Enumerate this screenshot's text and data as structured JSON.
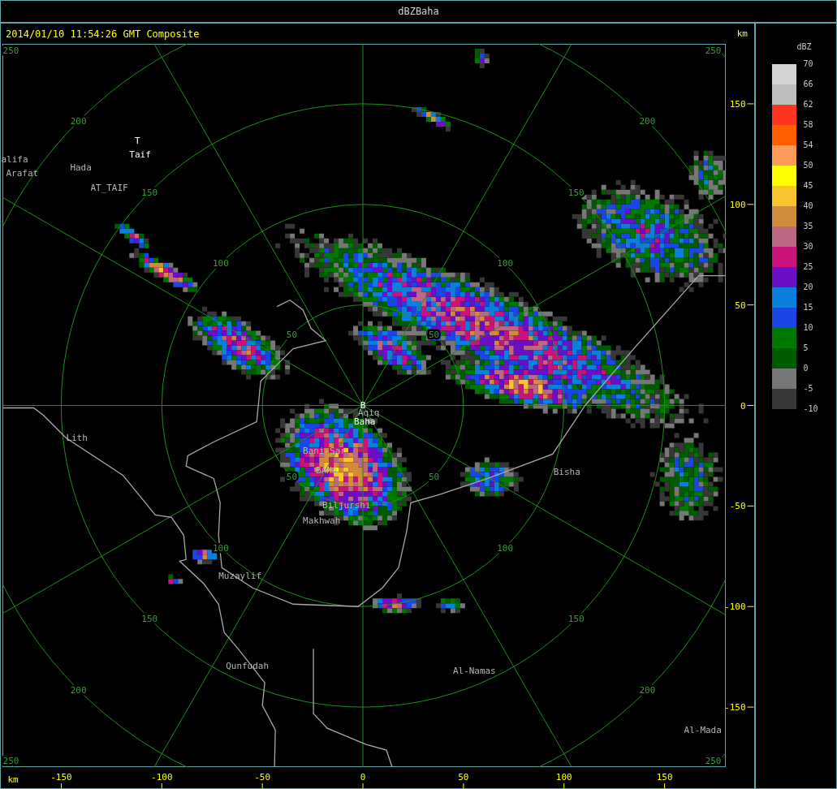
{
  "window": {
    "title": "dBZBaha"
  },
  "header": {
    "timestamp": "2014/01/10 11:54:26 GMT Composite",
    "unit": "km"
  },
  "map": {
    "range_rings": [
      {
        "labels": [
          "50",
          "50",
          "50",
          "50"
        ]
      },
      {
        "labels": [
          "100",
          "100",
          "100",
          "100"
        ]
      },
      {
        "labels": [
          "150",
          "150",
          "150",
          "150"
        ]
      },
      {
        "labels": [
          "200",
          "200",
          "200",
          "200"
        ]
      },
      {
        "labels": [
          "250",
          "250",
          "250",
          "250"
        ]
      }
    ],
    "places": [
      {
        "name": "Taif",
        "kind": "major",
        "marker": "T"
      },
      {
        "name": "alifa",
        "kind": "minor"
      },
      {
        "name": "Hada",
        "kind": "minor"
      },
      {
        "name": "Arafat",
        "kind": "minor"
      },
      {
        "name": "AT_TAIF",
        "kind": "minor"
      },
      {
        "name": "Aqiq",
        "kind": "minor"
      },
      {
        "name": "Baha",
        "kind": "major",
        "marker": "B"
      },
      {
        "name": "Lith",
        "kind": "minor"
      },
      {
        "name": "Bani-Sar",
        "kind": "minor"
      },
      {
        "name": "BAHA",
        "kind": "minor"
      },
      {
        "name": "Bisha",
        "kind": "minor"
      },
      {
        "name": "Biljurshi",
        "kind": "minor"
      },
      {
        "name": "Makhwah",
        "kind": "minor"
      },
      {
        "name": "Muzaylif",
        "kind": "minor"
      },
      {
        "name": "Qunfudah",
        "kind": "minor"
      },
      {
        "name": "Al-Namas",
        "kind": "minor"
      },
      {
        "name": "Al-Mada",
        "kind": "minor"
      }
    ]
  },
  "y_axis": {
    "ticks": [
      "150",
      "100",
      "50",
      "0",
      "-50",
      "-100",
      "-150"
    ]
  },
  "x_axis": {
    "unit": "km",
    "ticks": [
      "-150",
      "-100",
      "-50",
      "0",
      "50",
      "100",
      "150"
    ]
  },
  "legend": {
    "title": "dBZ",
    "bins": [
      {
        "color": "#d4d4d4"
      },
      {
        "color": "#bebebe"
      },
      {
        "color": "#ff3520"
      },
      {
        "color": "#ff5f00"
      },
      {
        "color": "#ff9b5a"
      },
      {
        "color": "#ffff00"
      },
      {
        "color": "#f8c530"
      },
      {
        "color": "#d18b3c"
      },
      {
        "color": "#bc6784"
      },
      {
        "color": "#c8137c"
      },
      {
        "color": "#6a0fc5"
      },
      {
        "color": "#0a7fdc"
      },
      {
        "color": "#1c45e6"
      },
      {
        "color": "#007800"
      },
      {
        "color": "#005a00"
      },
      {
        "color": "#777777"
      },
      {
        "color": "#373737"
      }
    ],
    "labels": [
      "70",
      "66",
      "62",
      "58",
      "54",
      "50",
      "45",
      "40",
      "35",
      "30",
      "25",
      "20",
      "15",
      "10",
      "5",
      "0",
      "-5",
      "-10"
    ]
  }
}
